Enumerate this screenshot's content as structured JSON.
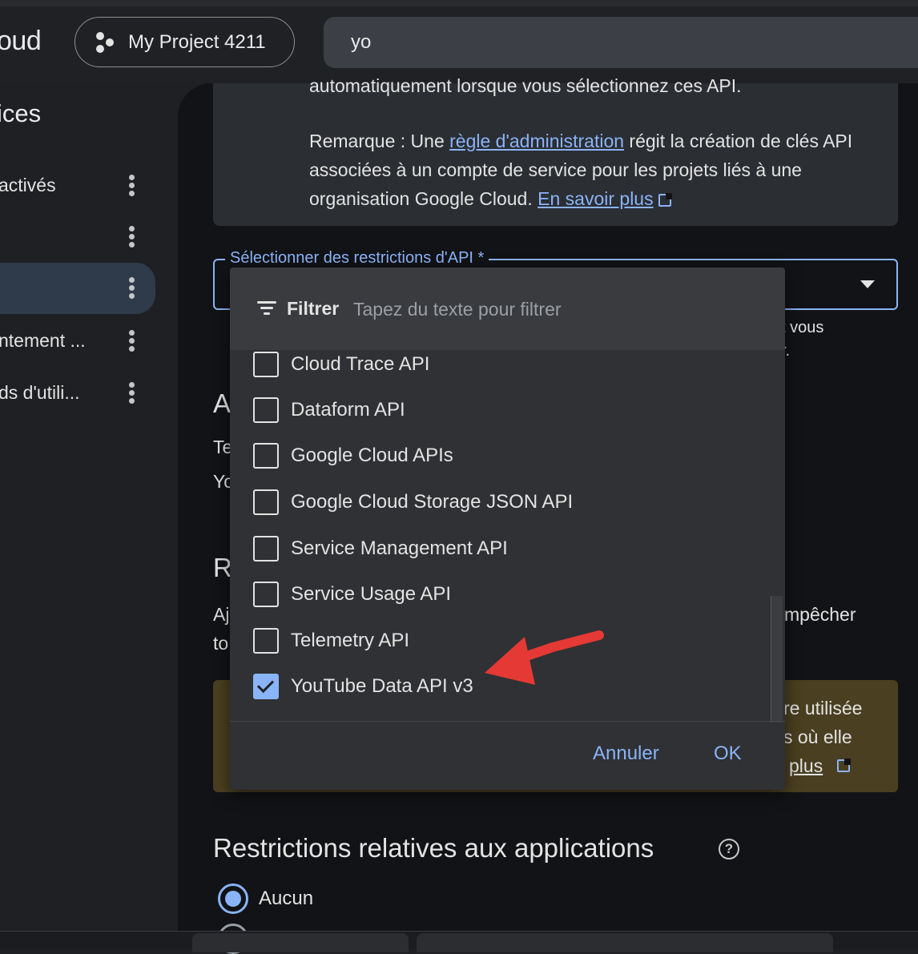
{
  "header": {
    "brand_partial": "oud",
    "project_name": "My Project 4211",
    "search_value": "yo"
  },
  "sidebar": {
    "title_partial": "ices",
    "items": [
      {
        "label": "activés"
      },
      {
        "label": ""
      },
      {
        "label": ""
      },
      {
        "label": "ntement ..."
      },
      {
        "label": "ds d'utili..."
      }
    ]
  },
  "info": {
    "cut_line": "automatiquement lorsque vous sélectionnez ces API.",
    "note_prefix": "Remarque : Une ",
    "note_link": "règle d'administration",
    "note_rest": " régit la création de clés API associées à un compte de service pour les projets liés à une organisation Google Cloud. ",
    "learn_more": "En savoir plus"
  },
  "api_select": {
    "label": "Sélectionner des restrictions d'API *",
    "peek_right_1": "t vous",
    "peek_right_2": "r."
  },
  "background": {
    "heading_a": "A",
    "text_te": "Te",
    "text_yo": "Yo",
    "heading_r": "R",
    "text_aj": "Aj",
    "text_to": "to",
    "peek_empecher": "mpêcher",
    "warn_line1": "re utilisée",
    "warn_line2": "s où elle",
    "warn_link": "plus"
  },
  "app_restrictions": {
    "title": "Restrictions relatives aux applications",
    "help_glyph": "?",
    "option_none": "Aucun"
  },
  "popup": {
    "filter_label": "Filtrer",
    "filter_placeholder": "Tapez du texte pour filtrer",
    "options": [
      {
        "label": "Cloud Trace API",
        "checked": false
      },
      {
        "label": "Dataform API",
        "checked": false
      },
      {
        "label": "Google Cloud APIs",
        "checked": false
      },
      {
        "label": "Google Cloud Storage JSON API",
        "checked": false
      },
      {
        "label": "Service Management API",
        "checked": false
      },
      {
        "label": "Service Usage API",
        "checked": false
      },
      {
        "label": "Telemetry API",
        "checked": false
      },
      {
        "label": "YouTube Data API v3",
        "checked": true
      }
    ],
    "cancel_label": "Annuler",
    "ok_label": "OK"
  },
  "colors": {
    "accent": "#8ab4f8",
    "annotation_arrow": "#e53935",
    "warning_bg": "#4a3f20"
  }
}
